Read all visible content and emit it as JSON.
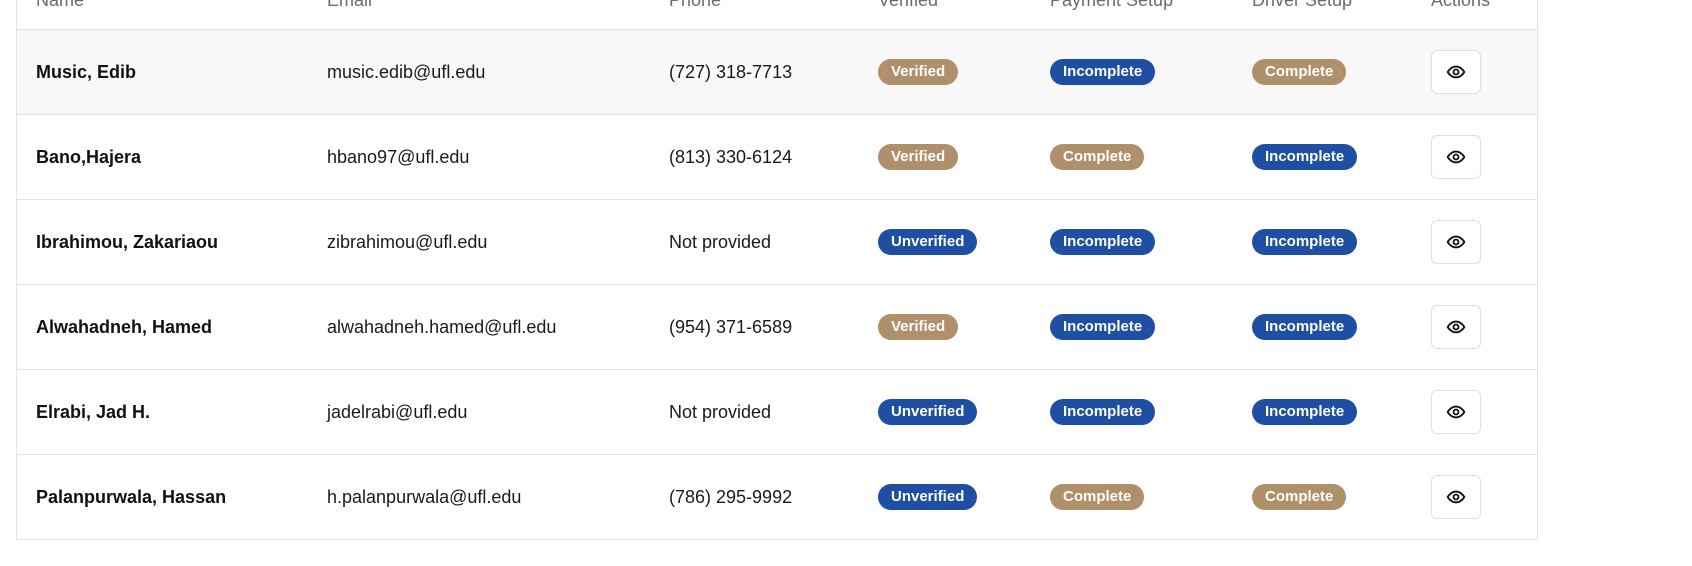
{
  "table": {
    "headers": {
      "name": "Name",
      "email": "Email",
      "phone": "Phone",
      "verified": "Verified",
      "payment": "Payment Setup",
      "driver": "Driver Setup",
      "actions": "Actions"
    },
    "rows": [
      {
        "name": "Music, Edib",
        "email": "music.edib@ufl.edu",
        "phone": "(727) 318-7713",
        "verified": "Verified",
        "payment": "Incomplete",
        "driver": "Complete"
      },
      {
        "name": "Bano,Hajera",
        "email": "hbano97@ufl.edu",
        "phone": "(813) 330-6124",
        "verified": "Verified",
        "payment": "Complete",
        "driver": "Incomplete"
      },
      {
        "name": "Ibrahimou, Zakariaou",
        "email": "zibrahimou@ufl.edu",
        "phone": "Not provided",
        "verified": "Unverified",
        "payment": "Incomplete",
        "driver": "Incomplete"
      },
      {
        "name": "Alwahadneh, Hamed",
        "email": "alwahadneh.hamed@ufl.edu",
        "phone": "(954) 371-6589",
        "verified": "Verified",
        "payment": "Incomplete",
        "driver": "Incomplete"
      },
      {
        "name": "Elrabi, Jad H.",
        "email": "jadelrabi@ufl.edu",
        "phone": "Not provided",
        "verified": "Unverified",
        "payment": "Incomplete",
        "driver": "Incomplete"
      },
      {
        "name": "Palanpurwala, Hassan",
        "email": "h.palanpurwala@ufl.edu",
        "phone": "(786) 295-9992",
        "verified": "Unverified",
        "payment": "Complete",
        "driver": "Complete"
      }
    ]
  },
  "icons": {
    "view": "eye-icon"
  },
  "colors": {
    "badge_tan": "#b08f6b",
    "badge_blue": "#1e4fa3",
    "hover_row": "#f8f8f8"
  }
}
